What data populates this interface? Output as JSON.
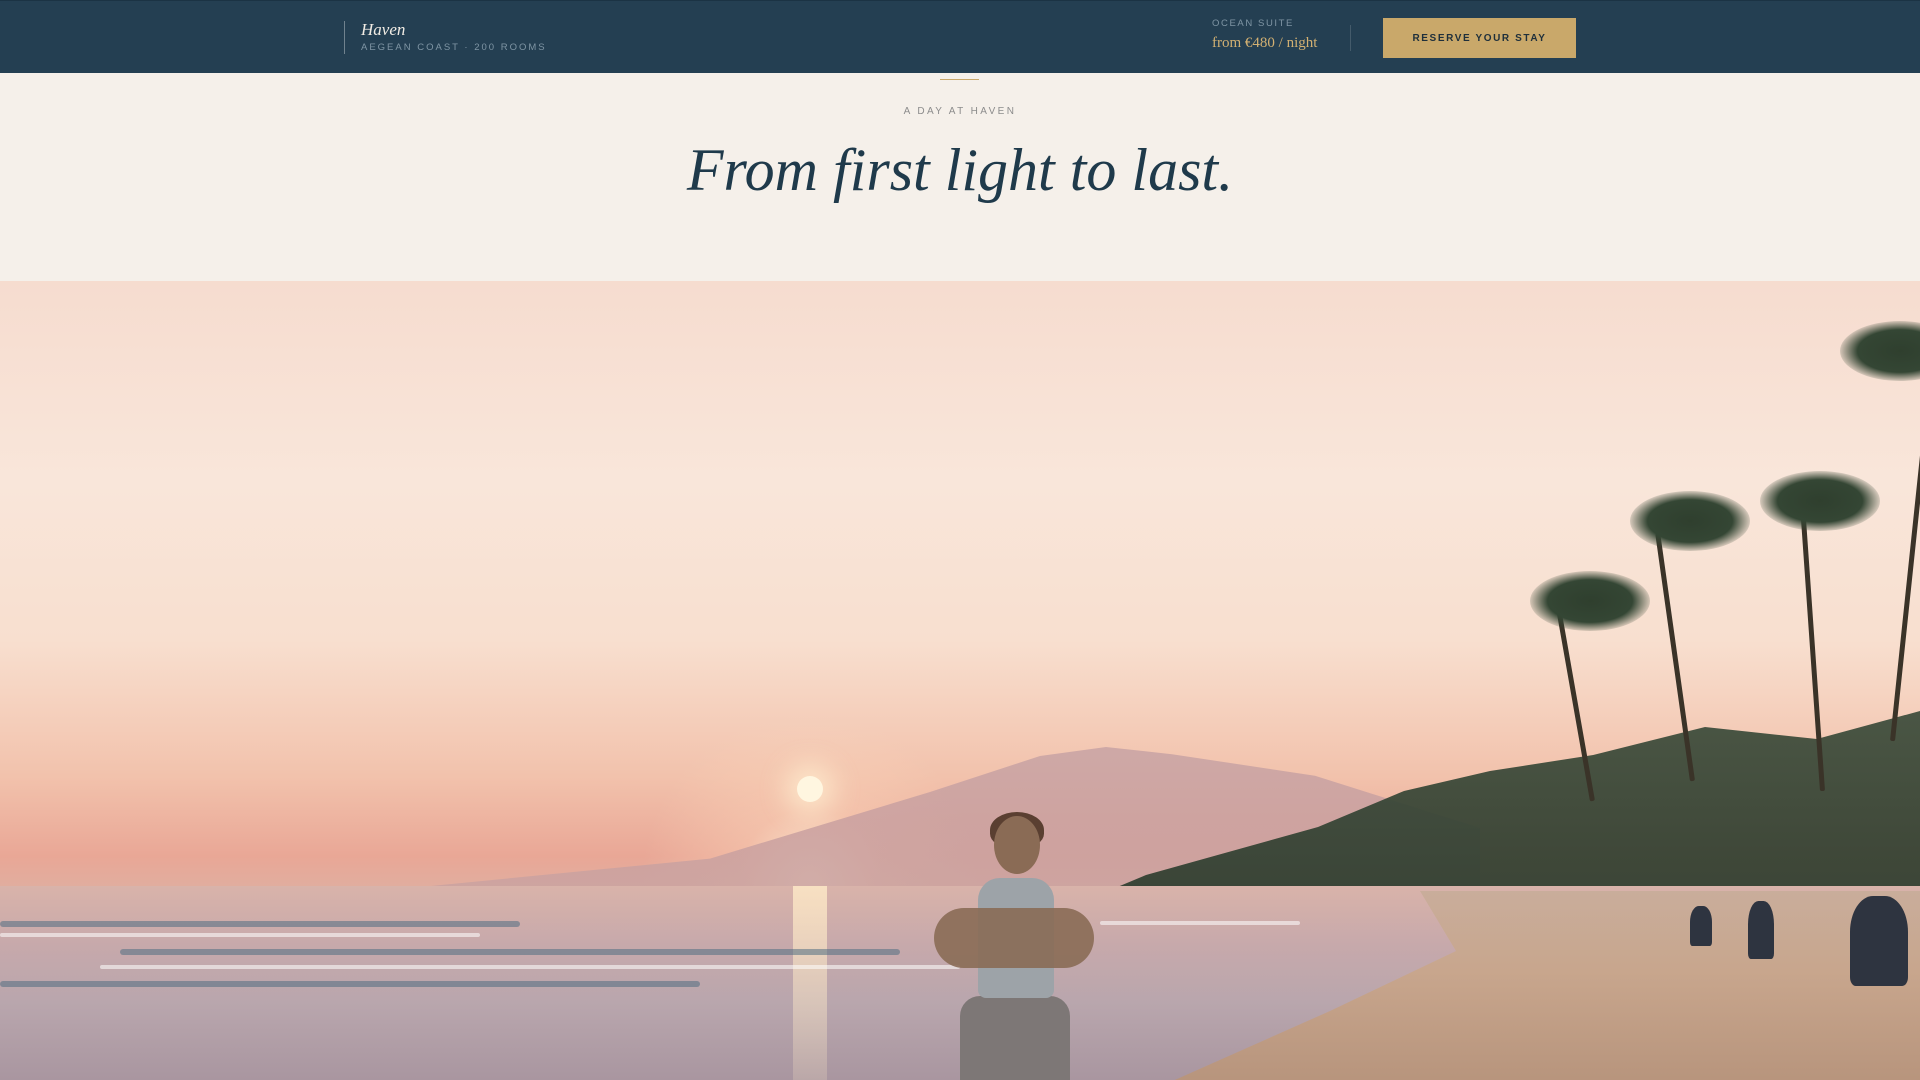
{
  "header": {
    "brand_name": "Haven",
    "brand_subtitle": "AEGEAN COAST · 200 ROOMS",
    "suite_label": "OCEAN SUITE",
    "suite_price": "from €480 / night",
    "reserve_label": "RESERVE YOUR STAY"
  },
  "intro": {
    "eyebrow": "A DAY AT HAVEN",
    "headline": "From first light to last."
  },
  "colors": {
    "navy": "#243f52",
    "gold": "#c9a86a",
    "cream": "#f5f0ea",
    "headline": "#1f3a4b"
  },
  "hero": {
    "image_name": "sunrise-beach-yoga-photo"
  }
}
